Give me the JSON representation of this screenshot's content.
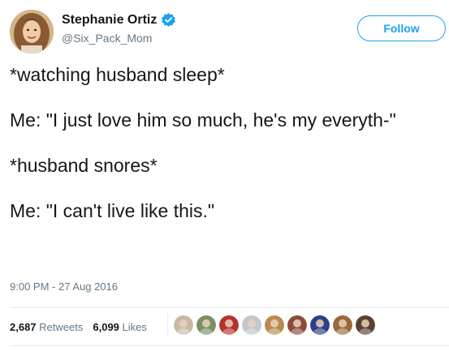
{
  "user": {
    "display_name": "Stephanie Ortiz",
    "handle": "@Six_Pack_Mom",
    "verified": true,
    "avatar_icon": "profile-photo-icon"
  },
  "follow_button": {
    "label": "Follow"
  },
  "tweet": {
    "lines": [
      "*watching husband sleep*",
      "Me: \"I just love him so much, he's my everyth-\"",
      "*husband snores*",
      "Me: \"I can't live like this.\""
    ],
    "timestamp": "9:00 PM - 27 Aug 2016"
  },
  "stats": {
    "retweets_count": "2,687",
    "retweets_label": "Retweets",
    "likes_count": "6,099",
    "likes_label": "Likes"
  },
  "likers": [
    {
      "icon": "liker-avatar-1-icon",
      "color": "#c8b9a6"
    },
    {
      "icon": "liker-avatar-2-icon",
      "color": "#7a8f66"
    },
    {
      "icon": "liker-avatar-3-icon",
      "color": "#b4322c"
    },
    {
      "icon": "liker-avatar-4-icon",
      "color": "#c1c7cd"
    },
    {
      "icon": "liker-avatar-5-icon",
      "color": "#b88a4f"
    },
    {
      "icon": "liker-avatar-6-icon",
      "color": "#8a4b3a"
    },
    {
      "icon": "liker-avatar-7-icon",
      "color": "#2c3e8c"
    },
    {
      "icon": "liker-avatar-8-icon",
      "color": "#9a6a3c"
    },
    {
      "icon": "liker-avatar-9-icon",
      "color": "#5a4033"
    }
  ],
  "colors": {
    "accent": "#1da1f2",
    "text": "#14171a",
    "muted": "#657786",
    "border": "#e6ecf0"
  }
}
